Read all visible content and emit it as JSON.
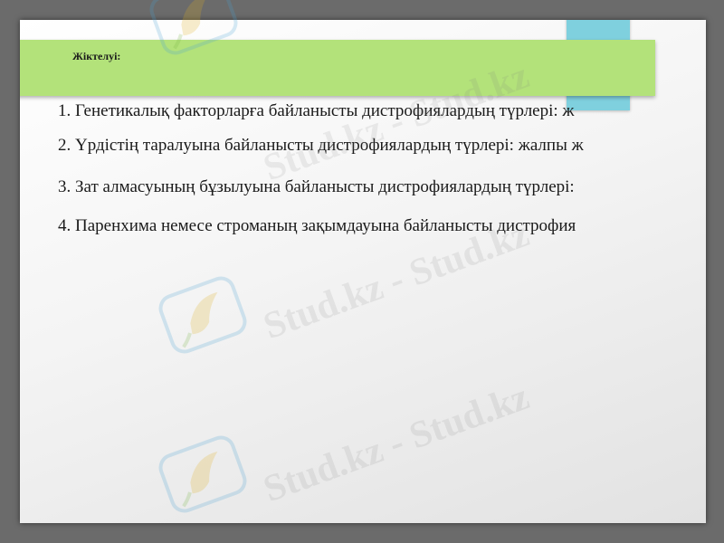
{
  "slide": {
    "title": "Жіктелуі:",
    "items": [
      "1. Генетикалық факторларға байланысты дистрофиялардың түрлері: ж",
      "2. Үрдістің таралуына байланысты дистрофиялардың түрлері: жалпы ж",
      "3. Зат алмасуының бұзылуына байланысты дистрофиялардың түрлері:",
      "4. Паренхима немесе строманың зақымдауына байланысты дистрофия"
    ]
  },
  "watermark": {
    "text": "Stud.kz - Stud.kz",
    "icon": "hummingbird-logo-icon"
  },
  "colors": {
    "title_band": "#b3e27a",
    "accent_tab": "#7fd0de",
    "background": "#6b6b6b"
  }
}
